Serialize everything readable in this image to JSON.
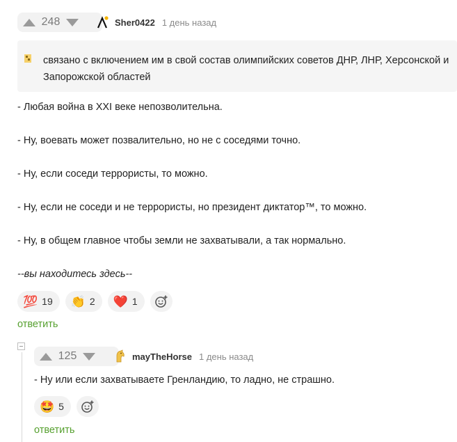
{
  "colors": {
    "accent_green": "#56a02f",
    "vote_arrow": "#9a9a9a"
  },
  "comment": {
    "rating": "248",
    "author": "Sher0422",
    "time": "1 день назад",
    "avatar_icon": "lambda-avatar-icon",
    "quote": "связано с включением им в свой состав олимпийских советов ДНР, ЛНР, Херсонской и Запорожской областей",
    "paragraphs": [
      "- Любая война в XXI веке непозволительна.",
      "- Ну, воевать может позвалительно, но не с соседями точно.",
      "- Ну, если соседи террористы, то можно.",
      "- Ну, если не соседи и не террористы, но президент диктатор™, то можно.",
      "- Ну, в общем главное чтобы земли не захватывали, а так нормально.",
      "--вы находитесь здесь--"
    ],
    "reactions": [
      {
        "emoji": "💯",
        "count": "19"
      },
      {
        "emoji": "👏",
        "count": "2"
      },
      {
        "emoji": "❤️",
        "count": "1"
      }
    ],
    "reply_label": "ответить"
  },
  "reply": {
    "rating": "125",
    "author": "mayTheHorse",
    "time": "1 день назад",
    "avatar_icon": "horse-avatar-icon",
    "text": "- Ну или если захватываете Гренландию, то ладно, не страшно.",
    "reactions": [
      {
        "emoji": "🤩",
        "count": "5"
      }
    ],
    "reply_label": "ответить"
  }
}
